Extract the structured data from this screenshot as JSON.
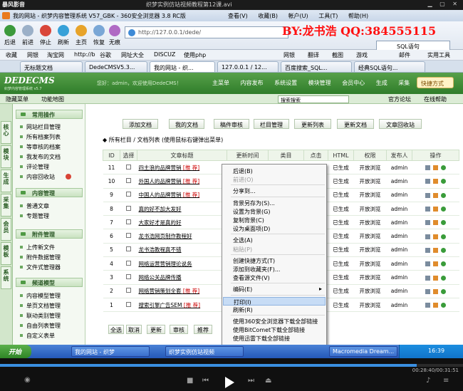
{
  "player": {
    "logo": "暴风影音",
    "file_name": "织梦实例仿站视频教程第12课.avi",
    "time": "00:28:40/00:31:51",
    "progress_fraction": 0.9
  },
  "browser": {
    "title": "我的网站 - 织梦内容管理系统 V57_GBK - 360安全浏览器 3.8 RC版",
    "menu": [
      "查看(V)",
      "收藏(B)",
      "帐户(U)",
      "工具(T)",
      "帮助(H)"
    ],
    "toolbar": [
      "后退",
      "前进",
      "停止",
      "刷新",
      "主页",
      "恢复",
      "无痕"
    ],
    "address": "http://127.0.0.1/dede/",
    "search_label": "SQL语句",
    "favorites": [
      "收藏",
      "网银",
      "淘宝网",
      "http://b",
      "谷歌",
      "网址大全",
      "DISCUZ",
      "使用php"
    ],
    "favorites_right": [
      "网银",
      "翻译",
      "截图",
      "游戏",
      "邮件",
      "实用工具"
    ],
    "tabs": [
      "无标题文档",
      "DedeCMSV5.3...",
      "我的网站 - 织...",
      "127.0.0.1 / 12...",
      "百度搜索_SQL...",
      "经典SQL语句..."
    ],
    "active_tab": 2
  },
  "watermark": "BY:龙书浩 QQ:384555115",
  "dede": {
    "logo": "DEDECMS",
    "logo_sub": "织梦内容管理系统 v5.7",
    "welcome": "您好：admin，欢迎使用DedeCMS！",
    "nav": [
      "主菜单",
      "内容发布",
      "系统设置",
      "模块管理",
      "会员中心",
      "生成",
      "采集",
      "模板"
    ],
    "quick_label": "快捷方式",
    "sub_left": [
      "隐藏菜单",
      "功能地图"
    ],
    "search_value": "搜索搜索",
    "sub_right": [
      "官方论坛",
      "在线帮助"
    ]
  },
  "side_strip": [
    "核心",
    "模块",
    "生成",
    "采集",
    "会员",
    "模板",
    "系统"
  ],
  "sidebar": {
    "sections": [
      {
        "title": "常用操作",
        "items": [
          "网站栏目管理",
          "所有档案列表",
          "等审核的档案",
          "我发布的文档",
          "评论管理",
          "内容回收站"
        ]
      },
      {
        "title": "内容管理",
        "items": [
          "普通文章",
          "专题管理"
        ]
      },
      {
        "title": "附件管理",
        "items": [
          "上传新文件",
          "附件数据管理",
          "文件式管理器"
        ]
      },
      {
        "title": "频道模型",
        "items": [
          "内容模型管理",
          "单页文档管理",
          "联动类别管理",
          "自由列表管理",
          "自定义表单"
        ]
      }
    ]
  },
  "actions": [
    "添加文档",
    "我的文档",
    "稿件审核",
    "栏目管理",
    "更新列表",
    "更新文档",
    "文章回收站"
  ],
  "list_heading": "所有栏目 / 文档列表 (使用鼠标右键弹出菜单)",
  "table": {
    "headers": [
      "ID",
      "选择",
      "文章标题",
      "更新时间",
      "类目",
      "点击",
      "HTML",
      "权限",
      "发布人",
      "操作"
    ],
    "rows": [
      {
        "id": "11",
        "title": "四主浪的品牌营销",
        "tag": "[推 荐]",
        "clicks": "56",
        "html": "已生成",
        "perm": "开放浏览",
        "author": "admin"
      },
      {
        "id": "10",
        "title": "外国人的品牌营销",
        "tag": "[推 荐]",
        "clicks": "65",
        "html": "已生成",
        "perm": "开放浏览",
        "author": "admin"
      },
      {
        "id": "9",
        "title": "中国人的品牌营销",
        "tag": "[推 荐]",
        "clicks": "59",
        "html": "已生成",
        "perm": "开放浏览",
        "author": "admin"
      },
      {
        "id": "8",
        "title": "真的好不加大发好",
        "tag": "",
        "clicks": "55",
        "html": "已生成",
        "perm": "开放浏览",
        "author": "admin"
      },
      {
        "id": "7",
        "title": "大家好才是真的好",
        "tag": "",
        "clicks": "60",
        "html": "已生成",
        "perm": "开放浏览",
        "author": "admin"
      },
      {
        "id": "6",
        "title": "龙书浩网页制作教程好",
        "tag": "",
        "clicks": "112",
        "html": "已生成",
        "perm": "开放浏览",
        "author": "admin"
      },
      {
        "id": "5",
        "title": "龙书浩教程真不错",
        "tag": "",
        "clicks": "61",
        "html": "已生成",
        "perm": "开放浏览",
        "author": "admin"
      },
      {
        "id": "4",
        "title": "网络运营营销理论说务",
        "tag": "",
        "clicks": "86",
        "html": "已生成",
        "perm": "开放浏览",
        "author": "admin"
      },
      {
        "id": "3",
        "title": "网络公关品牌传播",
        "tag": "",
        "clicks": "103",
        "html": "已生成",
        "perm": "开放浏览",
        "author": "admin"
      },
      {
        "id": "2",
        "title": "网络营销策划全套",
        "tag": "[推 荐]",
        "clicks": "58",
        "html": "已生成",
        "perm": "开放浏览",
        "author": "admin"
      },
      {
        "id": "1",
        "title": "搜索引擎广告SEM",
        "tag": "[推 荐]",
        "clicks": "59",
        "html": "已生成",
        "perm": "开放浏览",
        "author": "admin"
      }
    ]
  },
  "bottom_buttons": [
    "全选",
    "取消",
    "更新",
    "审核",
    "推荐"
  ],
  "context_menu": [
    {
      "label": "后退(B)",
      "disabled": false
    },
    {
      "label": "前进(O)",
      "disabled": true
    },
    {
      "sep": true
    },
    {
      "label": "分享到...",
      "disabled": false
    },
    {
      "sep": true
    },
    {
      "label": "背景另存为(S)...",
      "disabled": false
    },
    {
      "label": "设置为背景(G)",
      "disabled": false
    },
    {
      "label": "复制背景(C)",
      "disabled": false
    },
    {
      "label": "设为桌面项(D)",
      "disabled": false
    },
    {
      "sep": true
    },
    {
      "label": "全选(A)",
      "disabled": false
    },
    {
      "label": "粘贴(P)",
      "disabled": true
    },
    {
      "sep": true
    },
    {
      "label": "创建快捷方式(T)",
      "disabled": false
    },
    {
      "label": "添加到收藏夹(F)...",
      "disabled": false
    },
    {
      "label": "查看源文件(V)",
      "disabled": false
    },
    {
      "sep": true
    },
    {
      "label": "编码(E)",
      "disabled": false,
      "submenu": true
    },
    {
      "sep": true
    },
    {
      "label": "打印(I)",
      "disabled": false,
      "highlight": true
    },
    {
      "label": "刷新(R)",
      "disabled": false
    },
    {
      "sep": true
    },
    {
      "label": "使用360安全浏览器下载全部链接",
      "disabled": false
    },
    {
      "label": "使用BitComet下载全部链接",
      "disabled": false
    },
    {
      "label": "使用迅雷下载全部链接",
      "disabled": false
    },
    {
      "label": "使用迅雷看看播放器播放",
      "disabled": false
    },
    {
      "label": "导出到 Microsoft Office Excel(X)",
      "disabled": false
    },
    {
      "sep": true
    },
    {
      "label": "属性(P)",
      "disabled": false
    }
  ],
  "taskbar": {
    "start": "开始",
    "tasks": [
      "我的网站 - 织梦",
      "织梦实例仿站视频",
      "Macromedia Dream..."
    ],
    "clock": "16:39"
  },
  "colors": {
    "dede_green": "#2f7d2a",
    "watermark_red": "#ff1010",
    "progress_blue": "#3a8fe0"
  }
}
